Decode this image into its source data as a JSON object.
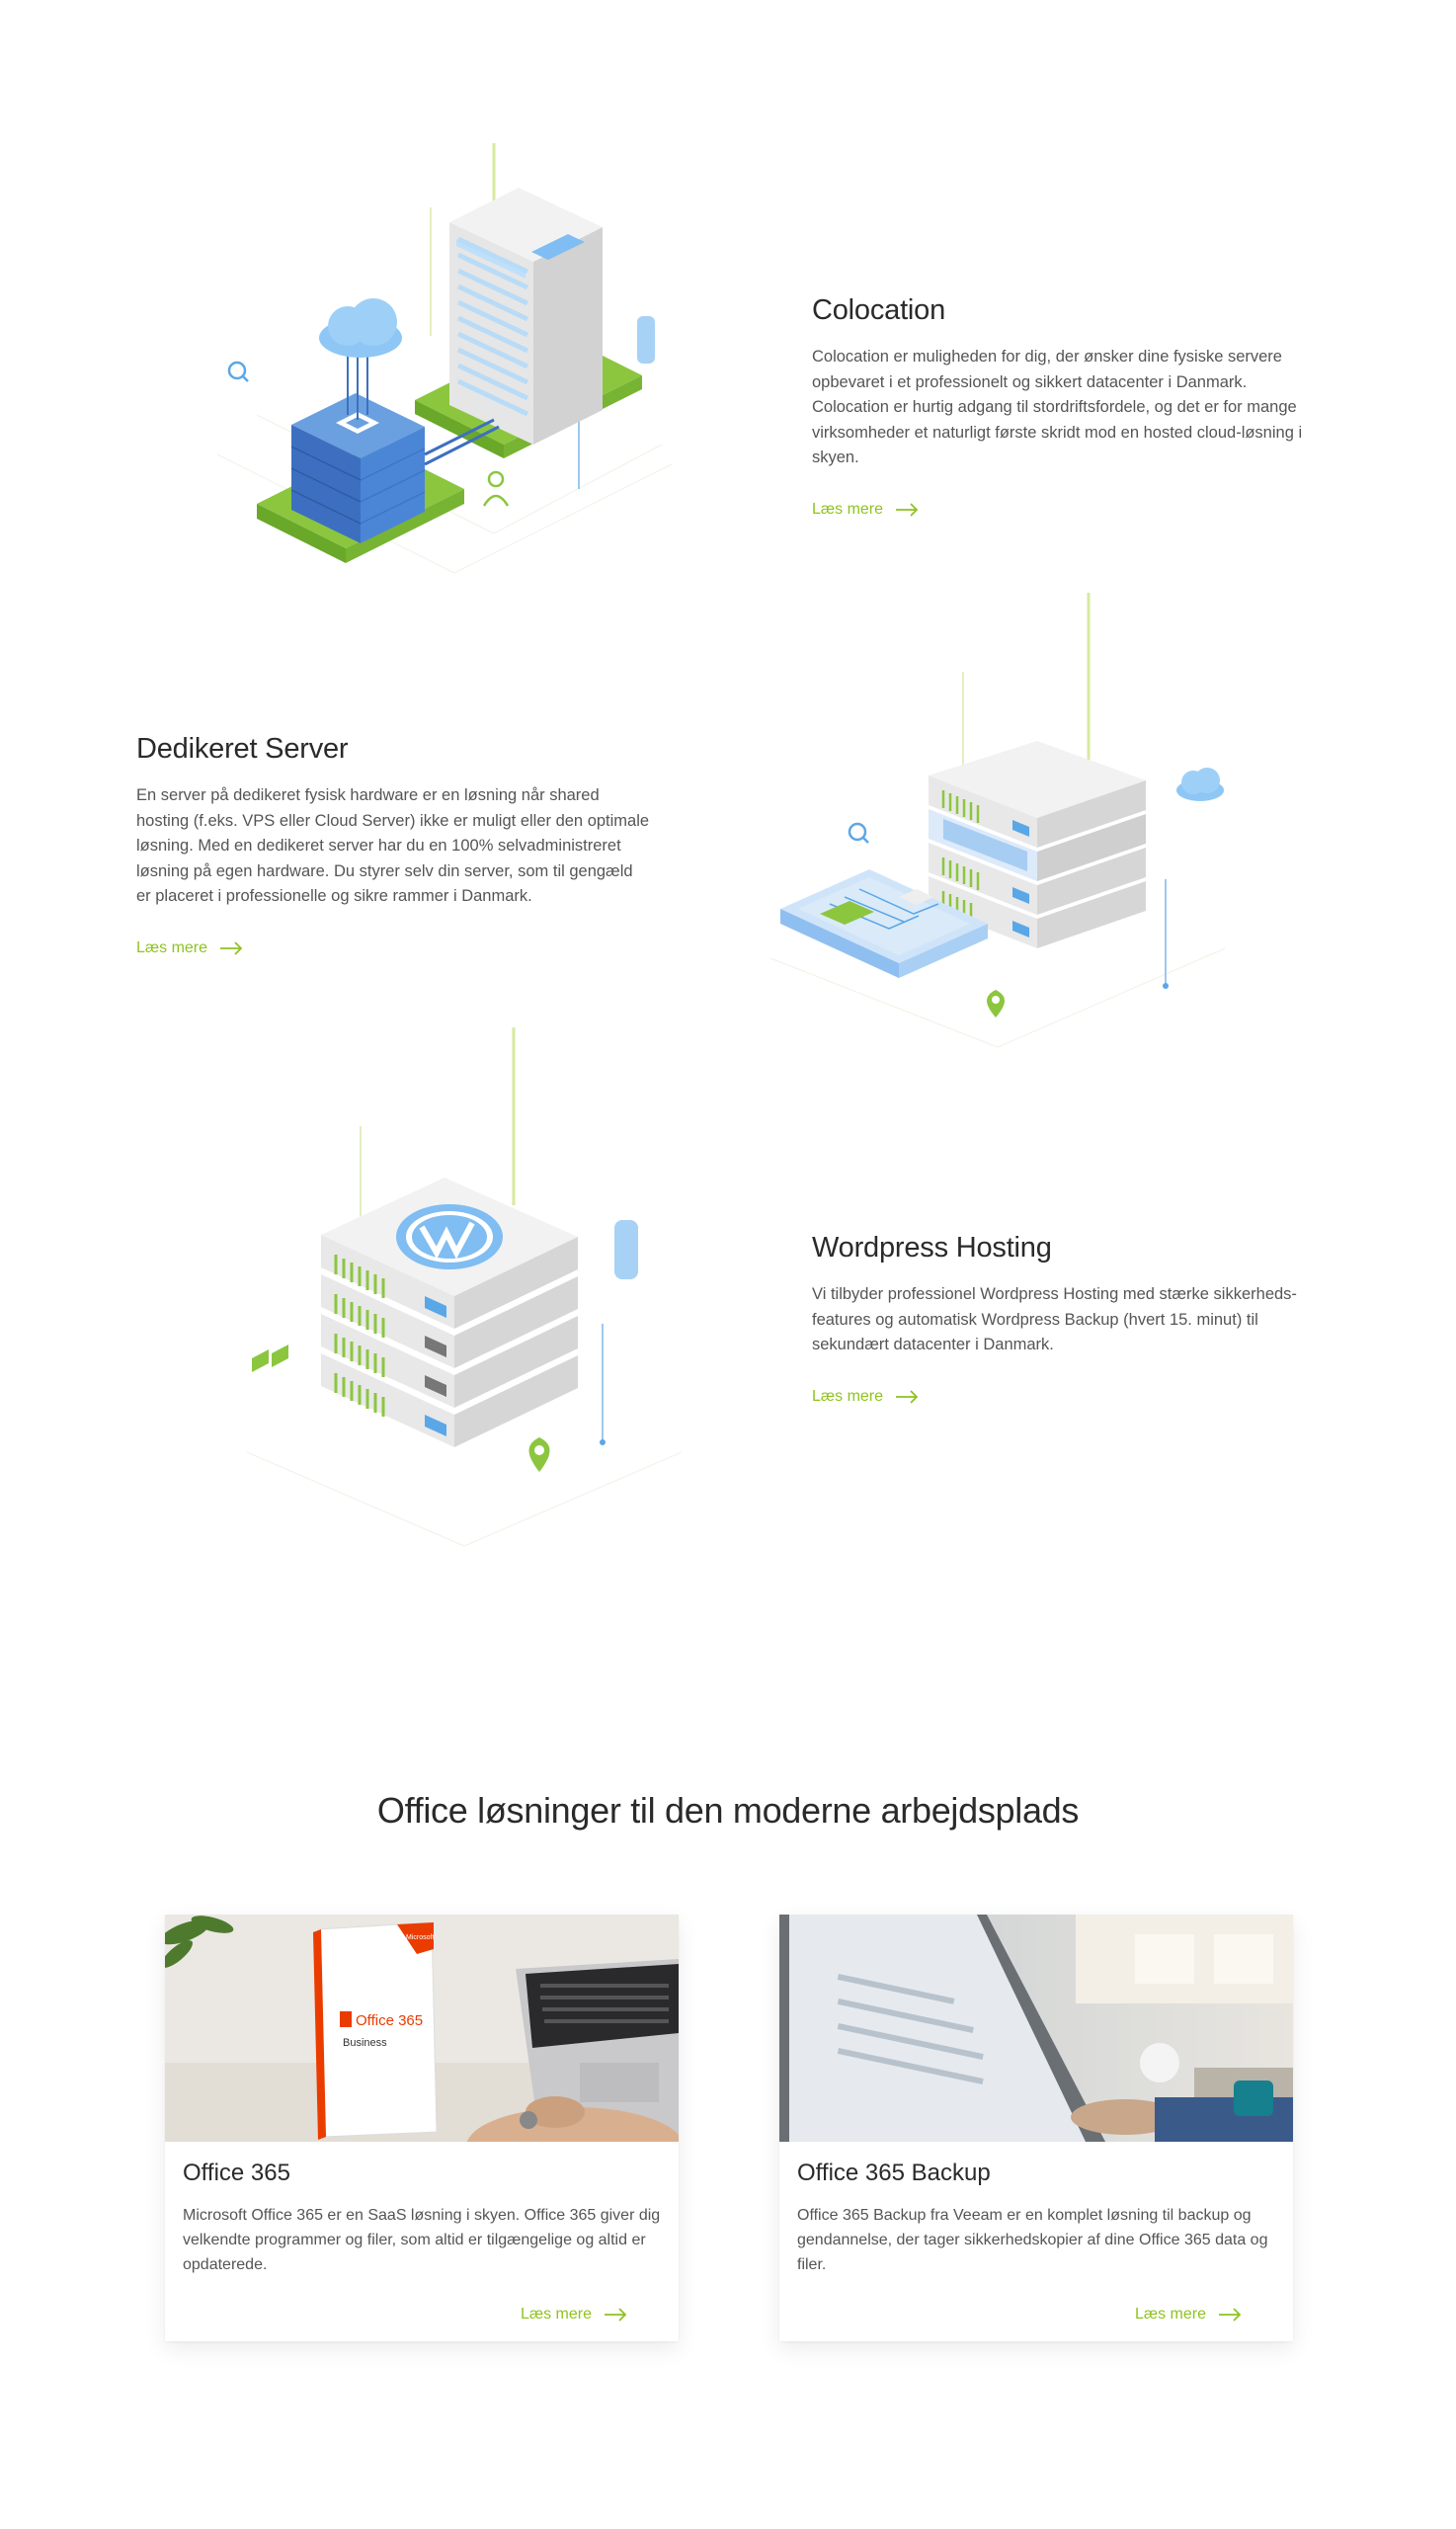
{
  "features": [
    {
      "title": "Colocation",
      "text": "Colocation er muligheden for dig, der ønsker dine fysiske servere opbevaret i et professionelt og sikkert datacenter i Danmark. Colocation er hurtig adgang til stordriftsfordele, og det er for mange virksomheder et naturligt første skridt mod en hosted cloud-løsning i skyen.",
      "link": "Læs mere"
    },
    {
      "title": "Dedikeret Server",
      "text": "En server på dedikeret fysisk hardware er en løsning når shared hosting (f.eks. VPS eller Cloud Server) ikke er muligt eller den optimale løsning. Med en dedikeret server har du en 100% selvadministreret løsning på egen hardware. Du styrer selv din server, som til gengæld er placeret i professionelle og sikre rammer i Danmark.",
      "link": "Læs mere"
    },
    {
      "title": "Wordpress Hosting",
      "text": "Vi tilbyder professionel Wordpress Hosting med stærke sikkerheds-features og automatisk Wordpress Backup (hvert 15. minut) til sekundært datacenter i Danmark.",
      "link": "Læs mere"
    }
  ],
  "office_section": {
    "title": "Office løsninger til den moderne arbejdsplads",
    "cards": [
      {
        "title": "Office 365",
        "text": "Microsoft Office 365 er en SaaS løsning i skyen. Office 365 giver dig velkendte programmer og filer, som altid er tilgængelige og altid er opdaterede.",
        "link": "Læs mere",
        "box_brand": "Microsoft",
        "box_product": "Office 365",
        "box_edition": "Business"
      },
      {
        "title": "Office 365 Backup",
        "text": "Office 365 Backup fra Veeam er en komplet løsning til backup og gendannelse, der tager sikkerhedskopier af dine Office 365 data og filer.",
        "link": "Læs mere"
      }
    ]
  },
  "colors": {
    "accent_green": "#8fc31f",
    "illustration_blue": "#5aa7e8",
    "heading": "#2a2a2a",
    "body_text": "#555555"
  },
  "icons": [
    "arrow-right-icon",
    "cloud-icon",
    "map-pin-icon",
    "wordpress-logo-icon",
    "search-icon",
    "user-icon"
  ]
}
